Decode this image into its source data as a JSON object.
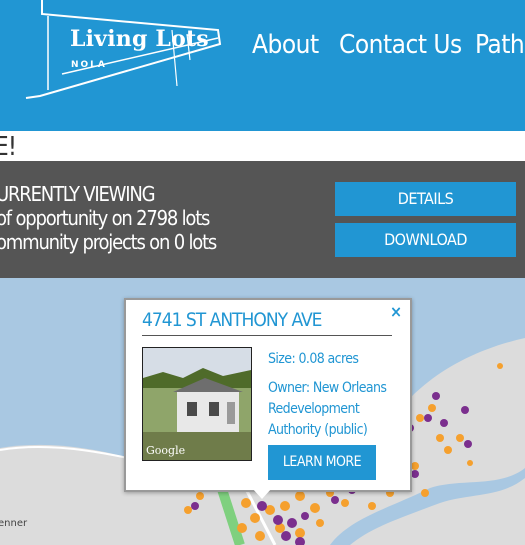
{
  "header": {
    "logo_title": "Living Lots",
    "logo_sub": "NOLA",
    "nav": {
      "about": "About",
      "contact": "Contact Us",
      "pathways": "Pathw"
    }
  },
  "strip": {
    "text": "E!"
  },
  "stats": {
    "line1": "URRENTLY VIEWING",
    "line2": "of opportunity on 2798 lots",
    "line3": "ommunity projects on 0 lots",
    "details_label": "DETAILS",
    "download_label": "DOWNLOAD"
  },
  "map": {
    "place_label": "enner",
    "popup": {
      "title": "4741 ST ANTHONY AVE",
      "close_icon": "×",
      "photo_credit": "Google",
      "size": "Size: 0.08 acres",
      "owner": "Owner: New Orleans Redevelopment Authority (public)",
      "learn_more": "LEARN MORE"
    }
  },
  "colors": {
    "brand_blue": "#2196d3",
    "stats_gray": "#555555",
    "map_land": "#dcdcdc",
    "lot_orange": "#f5a02e",
    "lot_purple": "#7b2f8e"
  }
}
